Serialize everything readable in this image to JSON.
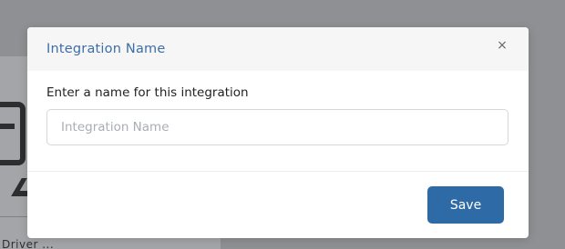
{
  "background": {
    "partial_text": "Driver ..."
  },
  "modal": {
    "title": "Integration Name",
    "close_label": "×",
    "field_label": "Enter a name for this integration",
    "input_value": "",
    "input_placeholder": "Integration Name",
    "save_label": "Save"
  },
  "colors": {
    "overlay": "#8e9093",
    "title": "#3d6ea6",
    "primary_button": "#2e6aa5",
    "input_border": "#d5d7da"
  }
}
